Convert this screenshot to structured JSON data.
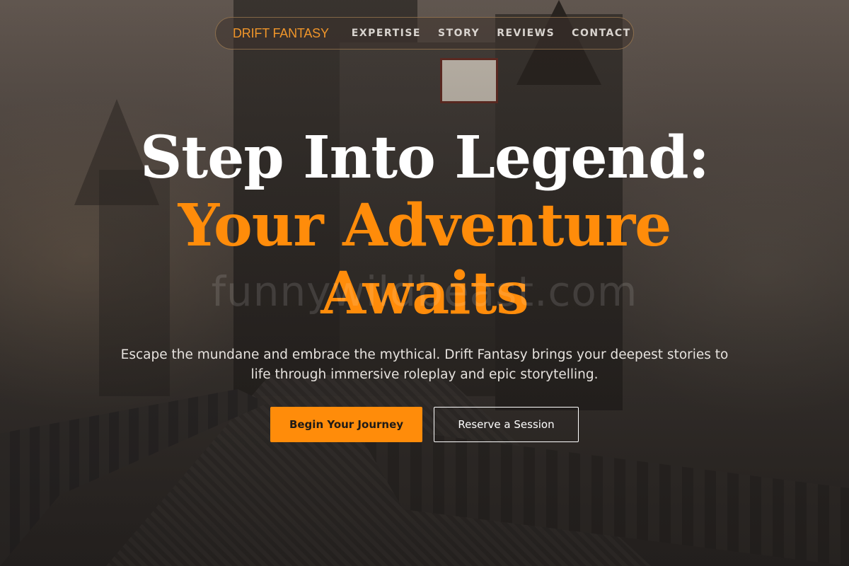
{
  "nav": {
    "brand": "DRIFT FANTASY",
    "links": [
      "EXPERTISE",
      "STORY",
      "REVIEWS",
      "CONTACT"
    ]
  },
  "hero": {
    "headline_line1": "Step Into Legend:",
    "headline_line2": "Your Adventure",
    "headline_line3": "Awaits",
    "subtitle": "Escape the mundane and embrace the mythical. Drift Fantasy brings your deepest stories to life through immersive roleplay and epic storytelling.",
    "primary_cta": "Begin Your Journey",
    "secondary_cta": "Reserve a Session"
  },
  "watermark": "funnywildbeast.com",
  "colors": {
    "accent": "#ff8c0a",
    "headline_white": "#ffffff"
  }
}
